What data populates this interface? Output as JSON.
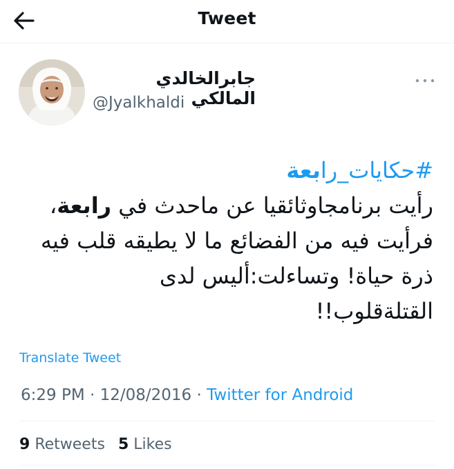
{
  "header": {
    "back_icon": "arrow-left-icon",
    "title": "Tweet"
  },
  "author": {
    "display_name": "جابرالخالدي المالكي",
    "handle": "@Jyalkhaldi",
    "more_icon": "more-dots-icon"
  },
  "tweet": {
    "hashtag_prefix": "#حكايات_را",
    "hashtag_bold": "بعة",
    "line1_start": "رأيت برنامجاوثائقيا عن ماحدث في ",
    "line1_bold": "رابعة",
    "line1_end": "،",
    "line2": "فرأيت فيه من الفضائع ما لا يطيقه قلب فيه",
    "line3": "ذرة حياة! وتساءلت:أليس لدى",
    "line4": "القتلةقلوب!!"
  },
  "translate_label": "Translate Tweet",
  "meta": {
    "time": "6:29 PM",
    "separator": "·",
    "date": "12/08/2016",
    "source": "Twitter for Android"
  },
  "stats": {
    "retweets_count": "9",
    "retweets_label": "Retweets",
    "likes_count": "5",
    "likes_label": "Likes"
  },
  "colors": {
    "link": "#1d9bf0",
    "secondary_text": "#536471",
    "primary_text": "#0f1419",
    "divider": "#eff3f4"
  }
}
